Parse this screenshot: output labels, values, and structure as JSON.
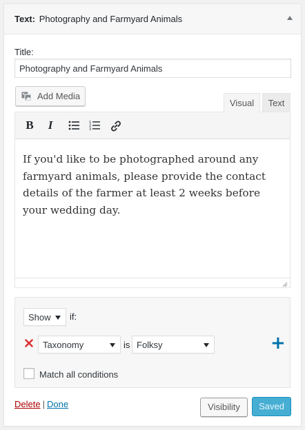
{
  "widget": {
    "type_label": "Text:",
    "name": "Photography and Farmyard Animals",
    "toggle_icon": "collapse-up-arrow-icon"
  },
  "form": {
    "title_label": "Title:",
    "title_value": "Photography and Farmyard Animals",
    "add_media_label": "Add Media",
    "add_media_icon": "add-media-icon"
  },
  "editor": {
    "tabs": [
      "Visual",
      "Text"
    ],
    "active_tab": "Visual",
    "toolbar": [
      {
        "name": "bold",
        "glyph": "B"
      },
      {
        "name": "italic",
        "glyph": "I"
      },
      {
        "name": "bulleted-list",
        "icon": "bulleted-list-icon"
      },
      {
        "name": "numbered-list",
        "icon": "numbered-list-icon"
      },
      {
        "name": "insert-link",
        "icon": "link-icon"
      }
    ],
    "content": "If you'd like to be photographed around any farmyard animals, please provide the contact details of the farmer at least 2 weeks before your wedding day."
  },
  "visibility": {
    "action": "Show",
    "if_label": "if:",
    "rule": {
      "field": "Taxonomy",
      "operator": "is",
      "value": "Folksy"
    },
    "add_icon": "+",
    "match_all_label": "Match all conditions",
    "match_all_checked": false
  },
  "footer": {
    "delete_label": "Delete",
    "separator": "|",
    "done_label": "Done",
    "visibility_button": "Visibility",
    "saved_button": "Saved"
  },
  "colors": {
    "link": "#0073aa",
    "delete_link": "#aa0000",
    "primary_button": "#33a6cf",
    "remove_icon": "#dc3232"
  }
}
